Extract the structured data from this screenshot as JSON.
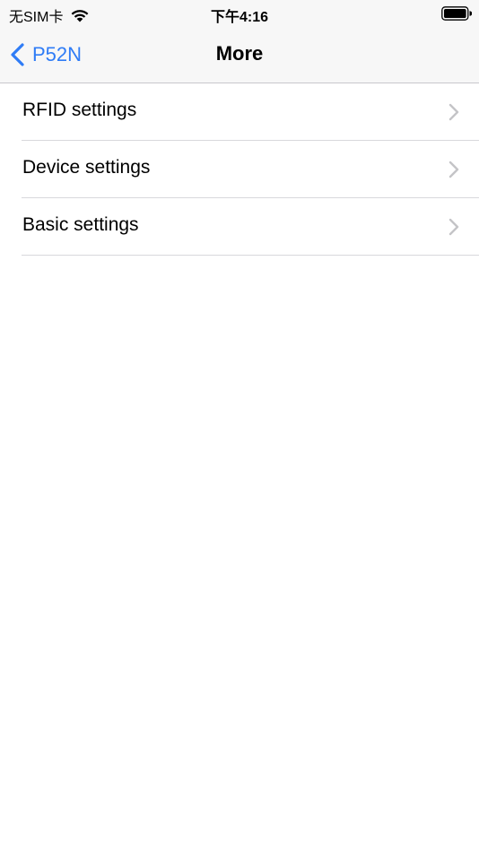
{
  "status_bar": {
    "carrier": "无SIM卡",
    "time": "下午4:16",
    "icons": [
      "wifi-icon",
      "battery-icon"
    ]
  },
  "nav": {
    "back_label": "P52N",
    "title": "More",
    "accent_color": "#2f7cf6"
  },
  "settings": {
    "items": [
      {
        "label": "RFID settings",
        "icon": "chevron-right-icon"
      },
      {
        "label": "Device settings",
        "icon": "chevron-right-icon"
      },
      {
        "label": "Basic settings",
        "icon": "chevron-right-icon"
      }
    ]
  }
}
